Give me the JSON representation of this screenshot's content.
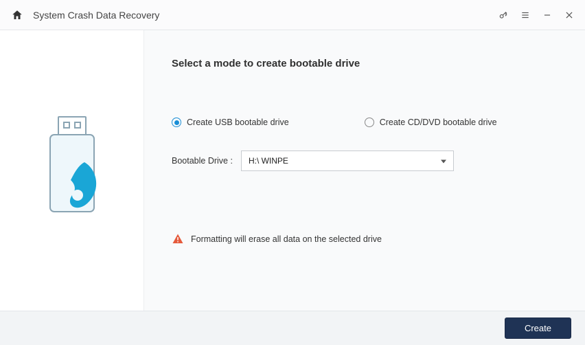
{
  "window": {
    "title": "System Crash Data Recovery"
  },
  "main": {
    "heading": "Select a mode to create bootable drive",
    "options": {
      "usb": "Create USB bootable drive",
      "cddvd": "Create CD/DVD bootable drive",
      "selected": "usb"
    },
    "drive": {
      "label": "Bootable Drive :",
      "value": "H:\\ WINPE"
    },
    "warning": "Formatting will erase all data on the selected drive"
  },
  "footer": {
    "create": "Create"
  }
}
